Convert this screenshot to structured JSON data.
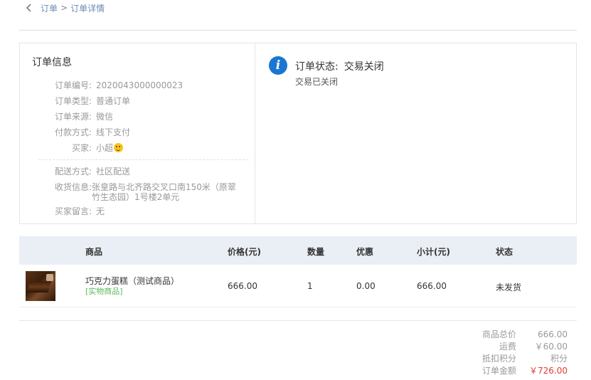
{
  "breadcrumb": {
    "parent": "订单",
    "separator": ">",
    "current": "订单详情"
  },
  "order_info": {
    "title": "订单信息",
    "fields": [
      {
        "label": "订单编号:",
        "value": "2020043000000023"
      },
      {
        "label": "订单类型:",
        "value": "普通订单"
      },
      {
        "label": "订单来源:",
        "value": "微信"
      },
      {
        "label": "付款方式:",
        "value": "线下支付"
      },
      {
        "label": "买家:",
        "value": "小超"
      }
    ],
    "delivery": {
      "method_label": "配送方式:",
      "method_value": "社区配送",
      "address_label": "收货信息:",
      "address_value": "张皇路与北齐路交叉口南150米（原翠竹生态园）1号楼2单元",
      "message_label": "买家留言:",
      "message_value": "无"
    }
  },
  "order_status": {
    "label": "订单状态:",
    "value": "交易关闭",
    "description": "交易已关闭",
    "icon": "info-icon",
    "icon_color": "#1a76d2"
  },
  "goods": {
    "headers": {
      "product": "商品",
      "price": "价格(元)",
      "quantity": "数量",
      "discount": "优惠",
      "subtotal": "小计(元)",
      "status": "状态"
    },
    "rows": [
      {
        "name": "巧克力蛋糕（测试商品）",
        "tag": "[实物商品]",
        "price": "666.00",
        "quantity": "1",
        "discount": "0.00",
        "subtotal": "666.00",
        "status": "未发货"
      }
    ]
  },
  "summary": {
    "goods_total_label": "商品总价",
    "goods_total_value": "666.00",
    "shipping_label": "运费",
    "shipping_value": "￥60.00",
    "points_label": "抵扣积分",
    "points_value": "积分",
    "order_amount_label": "订单金额",
    "order_amount_value": "￥726.00",
    "accent_color": "#e53935"
  }
}
